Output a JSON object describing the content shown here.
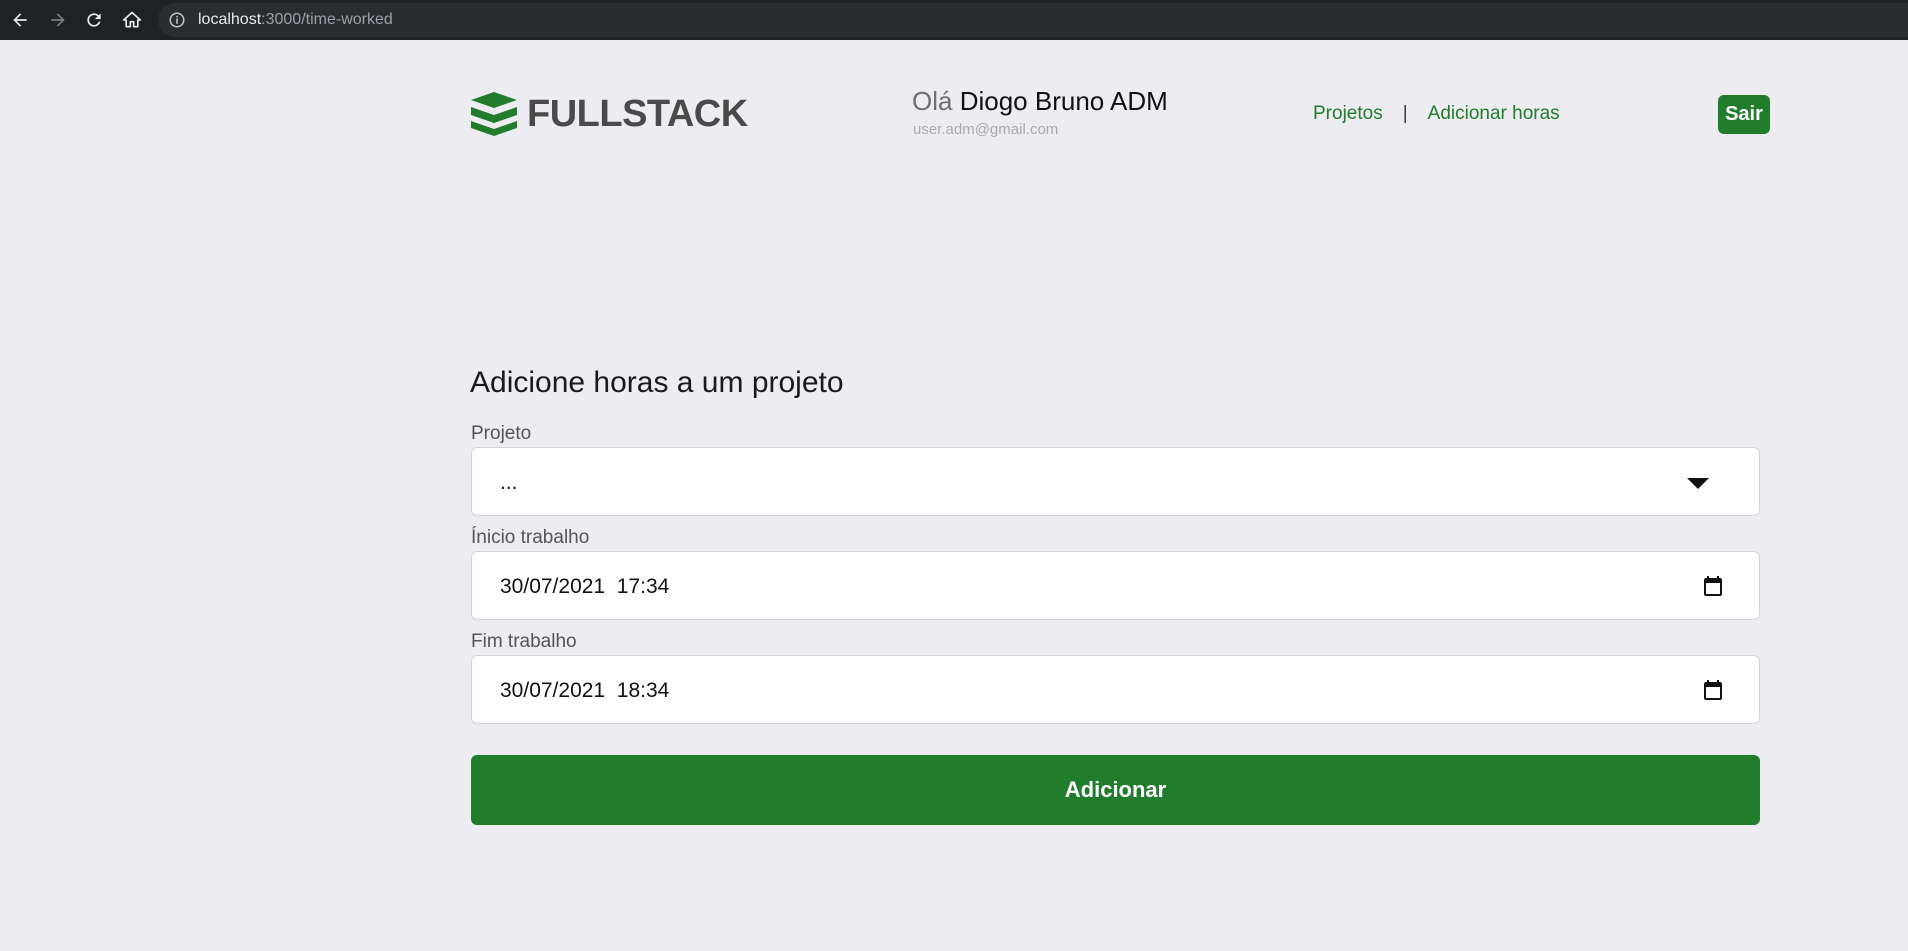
{
  "browser": {
    "url_host": "localhost",
    "url_path": ":3000/time-worked",
    "icons": [
      "back-arrow-icon",
      "forward-arrow-icon",
      "reload-icon",
      "home-icon",
      "info-icon"
    ]
  },
  "header": {
    "logo_text": "FULLSTACK",
    "greeting_word": "Olá",
    "user_name": "Diogo Bruno ADM",
    "user_email": "user.adm@gmail.com",
    "nav": {
      "projects": "Projetos",
      "separator": "|",
      "add_hours": "Adicionar horas"
    },
    "logout": "Sair"
  },
  "form": {
    "title": "Adicione horas a um projeto",
    "project_label": "Projeto",
    "project_value": "...",
    "start_label": "Ínicio trabalho",
    "start_value": "30/07/2021  17:34",
    "end_label": "Fim trabalho",
    "end_value": "30/07/2021  18:34",
    "submit": "Adicionar"
  },
  "colors": {
    "accent": "#217c2c",
    "background": "#ececf1",
    "chrome": "#202124"
  }
}
